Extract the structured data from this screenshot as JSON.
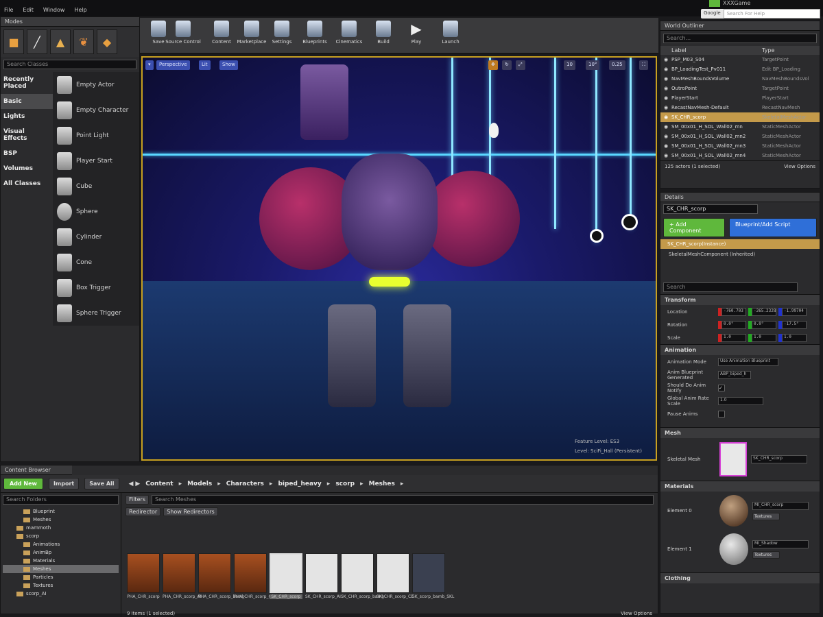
{
  "menubar": {
    "items": [
      "File",
      "Edit",
      "Window",
      "Help"
    ],
    "right_title": "XXXGame",
    "search_engine": "Google",
    "search_placeholder": "Search For Help"
  },
  "modes": {
    "tab": "Modes",
    "search_placeholder": "Search Classes",
    "categories": [
      "Recently Placed",
      "Basic",
      "Lights",
      "Visual Effects",
      "BSP",
      "Volumes",
      "All Classes"
    ],
    "selected_category": "Basic",
    "items": [
      "Empty Actor",
      "Empty Character",
      "Point Light",
      "Player Start",
      "Cube",
      "Sphere",
      "Cylinder",
      "Cone",
      "Box Trigger",
      "Sphere Trigger"
    ]
  },
  "toolbar": {
    "buttons": [
      "Save",
      "Source Control",
      "Content",
      "Marketplace",
      "Settings",
      "Blueprints",
      "Cinematics",
      "Build",
      "Play",
      "Launch"
    ]
  },
  "viewport": {
    "perspective": "Perspective",
    "lit": "Lit",
    "show": "Show",
    "feature_level": "Feature Level:  ES3",
    "level": "Level:  SciFi_Hall (Persistent)",
    "grid_size": "10",
    "rot_snap": "10°",
    "scale_snap": "0.25"
  },
  "outliner": {
    "tab": "World Outliner",
    "search_placeholder": "Search...",
    "col_label": "Label",
    "col_type": "Type",
    "rows": [
      {
        "label": "PSP_M03_S04",
        "type": "TargetPoint"
      },
      {
        "label": "BP_LoadingTest_Pv011",
        "type": "Edit BP_Loading"
      },
      {
        "label": "NavMeshBoundsVolume",
        "type": "NavMeshBoundsVol"
      },
      {
        "label": "OutroPoint",
        "type": "TargetPoint"
      },
      {
        "label": "PlayerStart",
        "type": "PlayerStart"
      },
      {
        "label": "RecastNavMesh-Default",
        "type": "RecastNavMesh"
      },
      {
        "label": "SK_CHR_scorp",
        "type": "SkeletalMeshActor"
      },
      {
        "label": "SM_00x01_H_SOL_Wall02_mn",
        "type": "StaticMeshActor"
      },
      {
        "label": "SM_00x01_H_SOL_Wall02_mn2",
        "type": "StaticMeshActor"
      },
      {
        "label": "SM_00x01_H_SOL_Wall02_mn3",
        "type": "StaticMeshActor"
      },
      {
        "label": "SM_00x01_H_SOL_Wall02_mn4",
        "type": "StaticMeshActor"
      }
    ],
    "selected_index": 6,
    "footer": "125 actors (1 selected)",
    "view_options": "View Options"
  },
  "details": {
    "tab": "Details",
    "name_value": "SK_CHR_scorp",
    "add_component": "+ Add Component",
    "blueprint_script": "Blueprint/Add Script",
    "instance_row": "SK_CHR_scorp(Instance)",
    "component_row": "SkeletalMeshComponent (Inherited)",
    "search_placeholder": "Search",
    "transform_header": "Transform",
    "location_label": "Location",
    "rotation_label": "Rotation",
    "scale_label": "Scale",
    "location": [
      "-760.703",
      "-265.2328",
      "-1.99704"
    ],
    "rotation": [
      "0.0°",
      "0.0°",
      "-17.5°"
    ],
    "scale": [
      "1.0",
      "1.0",
      "1.0"
    ],
    "animation_header": "Animation",
    "anim_mode_label": "Animation Mode",
    "anim_mode_value": "Use Animation Blueprint",
    "anim_bp_label": "Anim Blueprint Generated",
    "anim_bp_value": "ABP_biped_h",
    "should_do_anim_notify": "Should Do Anim Notify",
    "global_anim_rate": "Global Anim Rate Scale",
    "global_anim_rate_value": "1.0",
    "pause_anims": "Pause Anims",
    "mesh_header": "Mesh",
    "skeletal_mesh_label": "Skeletal Mesh",
    "skeletal_mesh_value": "SK_CHR_scorp",
    "materials_header": "Materials",
    "element0_label": "Element 0",
    "element0_value": "MI_CHR_scorp",
    "element1_label": "Element 1",
    "element1_value": "MI_Shadow",
    "textures_label": "Textures",
    "clothing_header": "Clothing"
  },
  "content_browser": {
    "tab": "Content Browser",
    "add_new": "Add New",
    "import": "Import",
    "save_all": "Save All",
    "breadcrumb": [
      "Content",
      "Models",
      "Characters",
      "biped_heavy",
      "scorp",
      "Meshes"
    ],
    "folder_search_placeholder": "Search Folders",
    "filters": "Filters",
    "asset_search_placeholder": "Search Meshes",
    "redirector": "Redirector",
    "show_redirectors": "Show Redirectors",
    "folders": [
      {
        "name": "Blueprint",
        "indent": 3
      },
      {
        "name": "Meshes",
        "indent": 3
      },
      {
        "name": "mammoth",
        "indent": 2
      },
      {
        "name": "scorp",
        "indent": 2
      },
      {
        "name": "Animations",
        "indent": 3
      },
      {
        "name": "AnimBp",
        "indent": 3
      },
      {
        "name": "Materials",
        "indent": 3
      },
      {
        "name": "Meshes",
        "indent": 3
      },
      {
        "name": "Particles",
        "indent": 3
      },
      {
        "name": "Textures",
        "indent": 3
      },
      {
        "name": "scorp_AI",
        "indent": 2
      }
    ],
    "selected_folder_index": 7,
    "assets": [
      "PHA_CHR_scorp",
      "PHA_CHR_scorp_AI",
      "PHA_CHR_scorp_bamb",
      "PHA_CHR_scorp_CE",
      "SK_CHR_scorp",
      "SK_CHR_scorp_AI",
      "SK_CHR_scorp_bamb",
      "SK_CHR_scorp_CE",
      "SK_scorp_bamb_SKL"
    ],
    "selected_asset_index": 4,
    "footer": "9 items (1 selected)",
    "view_options": "View Options"
  },
  "colors": {
    "accent_orange": "#c8a020",
    "add_green": "#5fb83c",
    "blueprint_blue": "#2f6fd8",
    "selection_gold": "#c49a4a"
  }
}
